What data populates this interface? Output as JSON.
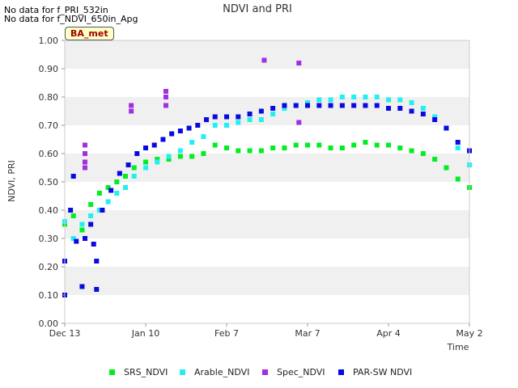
{
  "notes": [
    "No data for f_PRI_532in",
    "No data for f_NDVI_650in_Apg"
  ],
  "badge": "BA_met",
  "colors": {
    "SRS_NDVI": "#00ee22",
    "Arable_NDVI": "#22f0f0",
    "Spec_NDVI": "#a030e0",
    "PAR-SW NDVI": "#0a0ae0",
    "band": "#f0f0f0"
  },
  "chart_data": {
    "type": "scatter",
    "title": "NDVI and PRI",
    "xlabel": "Time",
    "ylabel": "NDVI, PRI",
    "ylim": [
      0.0,
      1.0
    ],
    "xlim": [
      "Dec 13",
      "May 2"
    ],
    "x_ticks": [
      "Dec 13",
      "Jan 10",
      "Feb 7",
      "Mar 7",
      "Apr 4",
      "May 2"
    ],
    "y_ticks": [
      "0.00",
      "0.10",
      "0.20",
      "0.30",
      "0.40",
      "0.50",
      "0.60",
      "0.70",
      "0.80",
      "0.90",
      "1.00"
    ],
    "grid": "alternating horizontal bands",
    "legend_position": "bottom",
    "series": [
      {
        "name": "SRS_NDVI",
        "points": [
          [
            "Dec 13",
            0.35
          ],
          [
            "Dec 16",
            0.38
          ],
          [
            "Dec 19",
            0.33
          ],
          [
            "Dec 22",
            0.42
          ],
          [
            "Dec 25",
            0.46
          ],
          [
            "Dec 28",
            0.48
          ],
          [
            "Dec 31",
            0.5
          ],
          [
            "Jan 3",
            0.52
          ],
          [
            "Jan 6",
            0.55
          ],
          [
            "Jan 10",
            0.57
          ],
          [
            "Jan 14",
            0.58
          ],
          [
            "Jan 18",
            0.58
          ],
          [
            "Jan 22",
            0.59
          ],
          [
            "Jan 26",
            0.59
          ],
          [
            "Jan 30",
            0.6
          ],
          [
            "Feb 3",
            0.63
          ],
          [
            "Feb 7",
            0.62
          ],
          [
            "Feb 11",
            0.61
          ],
          [
            "Feb 15",
            0.61
          ],
          [
            "Feb 19",
            0.61
          ],
          [
            "Feb 23",
            0.62
          ],
          [
            "Feb 27",
            0.62
          ],
          [
            "Mar 3",
            0.63
          ],
          [
            "Mar 7",
            0.63
          ],
          [
            "Mar 11",
            0.63
          ],
          [
            "Mar 15",
            0.62
          ],
          [
            "Mar 19",
            0.62
          ],
          [
            "Mar 23",
            0.63
          ],
          [
            "Mar 27",
            0.64
          ],
          [
            "Mar 31",
            0.63
          ],
          [
            "Apr 4",
            0.63
          ],
          [
            "Apr 8",
            0.62
          ],
          [
            "Apr 12",
            0.61
          ],
          [
            "Apr 16",
            0.6
          ],
          [
            "Apr 20",
            0.58
          ],
          [
            "Apr 24",
            0.55
          ],
          [
            "Apr 28",
            0.51
          ],
          [
            "May 2",
            0.48
          ]
        ]
      },
      {
        "name": "Arable_NDVI",
        "points": [
          [
            "Dec 13",
            0.36
          ],
          [
            "Dec 16",
            0.3
          ],
          [
            "Dec 19",
            0.35
          ],
          [
            "Dec 22",
            0.38
          ],
          [
            "Dec 25",
            0.4
          ],
          [
            "Dec 28",
            0.43
          ],
          [
            "Dec 31",
            0.46
          ],
          [
            "Jan 3",
            0.48
          ],
          [
            "Jan 6",
            0.52
          ],
          [
            "Jan 10",
            0.55
          ],
          [
            "Jan 14",
            0.57
          ],
          [
            "Jan 18",
            0.59
          ],
          [
            "Jan 22",
            0.61
          ],
          [
            "Jan 26",
            0.64
          ],
          [
            "Jan 30",
            0.66
          ],
          [
            "Feb 3",
            0.7
          ],
          [
            "Feb 7",
            0.7
          ],
          [
            "Feb 11",
            0.71
          ],
          [
            "Feb 15",
            0.72
          ],
          [
            "Feb 19",
            0.72
          ],
          [
            "Feb 23",
            0.74
          ],
          [
            "Feb 27",
            0.76
          ],
          [
            "Mar 3",
            0.77
          ],
          [
            "Mar 7",
            0.78
          ],
          [
            "Mar 11",
            0.79
          ],
          [
            "Mar 15",
            0.79
          ],
          [
            "Mar 19",
            0.8
          ],
          [
            "Mar 23",
            0.8
          ],
          [
            "Mar 27",
            0.8
          ],
          [
            "Mar 31",
            0.8
          ],
          [
            "Apr 4",
            0.79
          ],
          [
            "Apr 8",
            0.79
          ],
          [
            "Apr 12",
            0.78
          ],
          [
            "Apr 16",
            0.76
          ],
          [
            "Apr 20",
            0.73
          ],
          [
            "Apr 24",
            0.69
          ],
          [
            "Apr 28",
            0.62
          ],
          [
            "May 2",
            0.56
          ]
        ]
      },
      {
        "name": "Spec_NDVI",
        "points": [
          [
            "Dec 20",
            0.63
          ],
          [
            "Dec 20",
            0.6
          ],
          [
            "Dec 20",
            0.57
          ],
          [
            "Dec 20",
            0.55
          ],
          [
            "Jan 5",
            0.77
          ],
          [
            "Jan 5",
            0.75
          ],
          [
            "Jan 17",
            0.82
          ],
          [
            "Jan 17",
            0.8
          ],
          [
            "Jan 17",
            0.77
          ],
          [
            "Feb 20",
            0.93
          ],
          [
            "Mar 4",
            0.92
          ],
          [
            "Mar 4",
            0.71
          ]
        ]
      },
      {
        "name": "PAR-SW NDVI",
        "points": [
          [
            "Dec 13",
            0.1
          ],
          [
            "Dec 13",
            0.22
          ],
          [
            "Dec 15",
            0.4
          ],
          [
            "Dec 16",
            0.52
          ],
          [
            "Dec 17",
            0.29
          ],
          [
            "Dec 19",
            0.13
          ],
          [
            "Dec 20",
            0.3
          ],
          [
            "Dec 22",
            0.35
          ],
          [
            "Dec 23",
            0.28
          ],
          [
            "Dec 24",
            0.22
          ],
          [
            "Dec 24",
            0.12
          ],
          [
            "Dec 26",
            0.4
          ],
          [
            "Dec 29",
            0.47
          ],
          [
            "Jan 1",
            0.53
          ],
          [
            "Jan 4",
            0.56
          ],
          [
            "Jan 7",
            0.6
          ],
          [
            "Jan 10",
            0.62
          ],
          [
            "Jan 13",
            0.63
          ],
          [
            "Jan 16",
            0.65
          ],
          [
            "Jan 19",
            0.67
          ],
          [
            "Jan 22",
            0.68
          ],
          [
            "Jan 25",
            0.69
          ],
          [
            "Jan 28",
            0.7
          ],
          [
            "Jan 31",
            0.72
          ],
          [
            "Feb 3",
            0.73
          ],
          [
            "Feb 7",
            0.73
          ],
          [
            "Feb 11",
            0.73
          ],
          [
            "Feb 15",
            0.74
          ],
          [
            "Feb 19",
            0.75
          ],
          [
            "Feb 23",
            0.76
          ],
          [
            "Feb 27",
            0.77
          ],
          [
            "Mar 3",
            0.77
          ],
          [
            "Mar 7",
            0.77
          ],
          [
            "Mar 11",
            0.77
          ],
          [
            "Mar 15",
            0.77
          ],
          [
            "Mar 19",
            0.77
          ],
          [
            "Mar 23",
            0.77
          ],
          [
            "Mar 27",
            0.77
          ],
          [
            "Mar 31",
            0.77
          ],
          [
            "Apr 4",
            0.76
          ],
          [
            "Apr 8",
            0.76
          ],
          [
            "Apr 12",
            0.75
          ],
          [
            "Apr 16",
            0.74
          ],
          [
            "Apr 20",
            0.72
          ],
          [
            "Apr 24",
            0.69
          ],
          [
            "Apr 28",
            0.64
          ],
          [
            "May 2",
            0.61
          ]
        ]
      }
    ]
  }
}
